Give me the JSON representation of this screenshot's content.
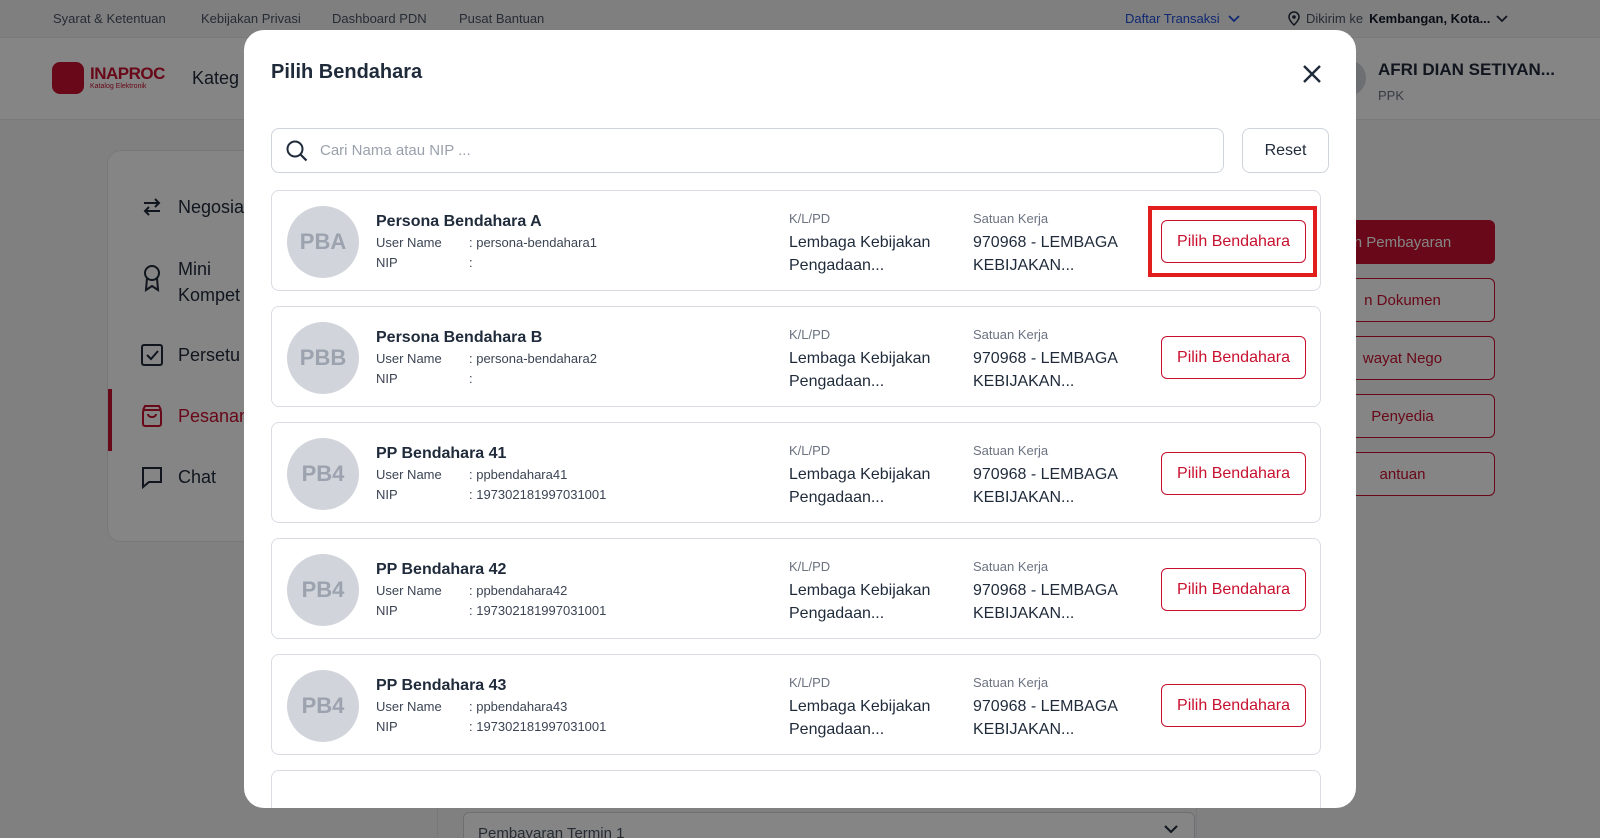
{
  "topbar": {
    "links": [
      "Syarat & Ketentuan",
      "Kebijakan Privasi",
      "Dashboard PDN",
      "Pusat Bantuan"
    ],
    "daftar_transaksi": "Daftar Transaksi",
    "dikirim_label": "Dikirim ke",
    "dikirim_value": "Kembangan, Kota..."
  },
  "header": {
    "logo_title": "INAPROC",
    "logo_subtitle": "Katalog Elektronik",
    "kategori": "Kateg",
    "user_name": "AFRI DIAN SETIYAN...",
    "user_role": "PPK"
  },
  "sidebar": {
    "items": [
      "Negosia",
      "Mini\nKompet",
      "Persetu",
      "Pesanan",
      "Chat"
    ]
  },
  "right_actions": [
    "n Pembayaran",
    "n Dokumen",
    "wayat Nego",
    "Penyedia",
    "antuan"
  ],
  "termin": "Pembayaran Termin 1",
  "modal": {
    "title": "Pilih Bendahara",
    "search_placeholder": "Cari Nama atau NIP ...",
    "reset_label": "Reset",
    "user_name_label": "User Name",
    "nip_label": "NIP",
    "klpd_label": "K/L/PD",
    "satker_label": "Satuan Kerja",
    "pick_label": "Pilih Bendahara",
    "items": [
      {
        "initials": "PBA",
        "name": "Persona Bendahara A",
        "username": ": persona-bendahara1",
        "nip": ":",
        "klpd": "Lembaga Kebijakan Pengadaan...",
        "satker": "970968 - LEMBAGA KEBIJAKAN..."
      },
      {
        "initials": "PBB",
        "name": "Persona Bendahara B",
        "username": ": persona-bendahara2",
        "nip": ":",
        "klpd": "Lembaga Kebijakan Pengadaan...",
        "satker": "970968 - LEMBAGA KEBIJAKAN..."
      },
      {
        "initials": "PB4",
        "name": "PP Bendahara 41",
        "username": ": ppbendahara41",
        "nip": ": 197302181997031001",
        "klpd": "Lembaga Kebijakan Pengadaan...",
        "satker": "970968 - LEMBAGA KEBIJAKAN..."
      },
      {
        "initials": "PB4",
        "name": "PP Bendahara 42",
        "username": ": ppbendahara42",
        "nip": ": 197302181997031001",
        "klpd": "Lembaga Kebijakan Pengadaan...",
        "satker": "970968 - LEMBAGA KEBIJAKAN..."
      },
      {
        "initials": "PB4",
        "name": "PP Bendahara 43",
        "username": ": ppbendahara43",
        "nip": ": 197302181997031001",
        "klpd": "Lembaga Kebijakan Pengadaan...",
        "satker": "970968 - LEMBAGA KEBIJAKAN..."
      }
    ]
  },
  "colors": {
    "brand": "#c8102e",
    "highlight": "#e11d1d",
    "link": "#1d4ed8"
  }
}
